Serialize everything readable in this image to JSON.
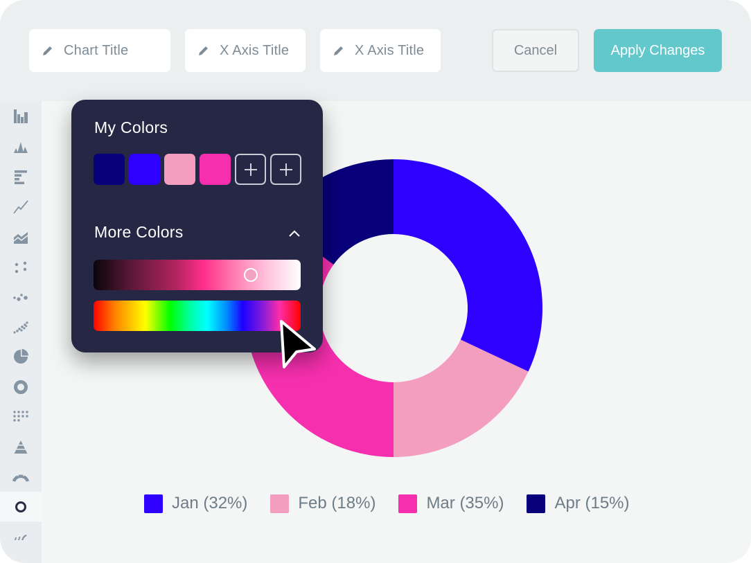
{
  "toolbar": {
    "chart_title_placeholder": "Chart Title",
    "x_axis_title_placeholder": "X Axis Title",
    "second_axis_title_placeholder": "X Axis Title",
    "cancel_label": "Cancel",
    "apply_label": "Apply Changes",
    "apply_color": "#63c8cc"
  },
  "sidebar": {
    "items": [
      {
        "name": "column-chart",
        "icon": "column-chart-icon"
      },
      {
        "name": "spike-chart",
        "icon": "spike-chart-icon"
      },
      {
        "name": "bar-chart",
        "icon": "horizontal-bar-chart-icon"
      },
      {
        "name": "line-chart",
        "icon": "line-chart-icon"
      },
      {
        "name": "area-chart",
        "icon": "area-chart-icon"
      },
      {
        "name": "scatter-chart",
        "icon": "scatter-chart-icon"
      },
      {
        "name": "bubble-chart",
        "icon": "bubble-chart-icon"
      },
      {
        "name": "dense-scatter-chart",
        "icon": "dense-scatter-icon"
      },
      {
        "name": "pie-chart",
        "icon": "pie-chart-icon"
      },
      {
        "name": "donut-chart",
        "icon": "donut-chart-icon"
      },
      {
        "name": "dot-matrix-chart",
        "icon": "dot-matrix-icon"
      },
      {
        "name": "pyramid-chart",
        "icon": "pyramid-chart-icon"
      },
      {
        "name": "gauge-chart",
        "icon": "gauge-chart-icon"
      },
      {
        "name": "ring-chart",
        "icon": "ring-chart-icon",
        "active": true
      },
      {
        "name": "wave-chart",
        "icon": "wave-chart-icon"
      }
    ]
  },
  "color_picker": {
    "my_colors_title": "My Colors",
    "my_colors": [
      "#08007a",
      "#2d00ff",
      "#f39ebf",
      "#f62fae"
    ],
    "add_slots": 2,
    "more_colors_title": "More Colors",
    "more_colors_expanded": true,
    "shade_slider_position": 0.76,
    "hue_slider_position": 0.9
  },
  "chart_data": {
    "type": "pie",
    "variant": "donut",
    "title": "",
    "categories": [
      "Jan",
      "Feb",
      "Mar",
      "Apr"
    ],
    "values": [
      32,
      18,
      35,
      15
    ],
    "unit": "%",
    "colors": [
      "#2d00ff",
      "#f39ebf",
      "#f62fae",
      "#08007a"
    ],
    "legend_labels": [
      "Jan (32%)",
      "Feb (18%)",
      "Mar (35%)",
      "Apr (15%)"
    ],
    "legend_position": "bottom",
    "start_angle": "top",
    "direction": "clockwise"
  }
}
